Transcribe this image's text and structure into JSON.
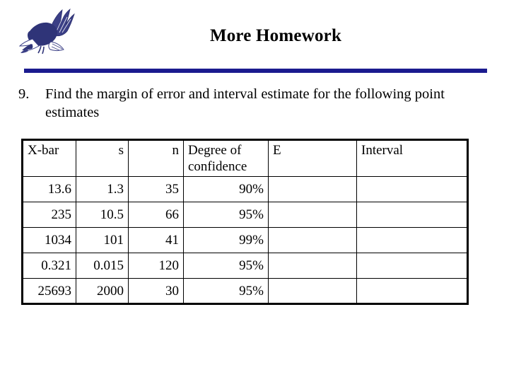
{
  "header": {
    "logo_icon": "eagle-logo",
    "title": "More Homework",
    "rule_color": "#1b1b8f"
  },
  "question": {
    "number": "9.",
    "text": "Find the margin of error and interval estimate for the following point estimates"
  },
  "table": {
    "columns": [
      {
        "label": "X-bar",
        "align": "left"
      },
      {
        "label": "s",
        "align": "right"
      },
      {
        "label": "n",
        "align": "right"
      },
      {
        "label": "Degree of confidence",
        "align": "left"
      },
      {
        "label": "E",
        "align": "left"
      },
      {
        "label": "Interval",
        "align": "left"
      }
    ],
    "rows": [
      {
        "xbar": "13.6",
        "s": "1.3",
        "n": "35",
        "confidence": "90%",
        "e": "",
        "interval": ""
      },
      {
        "xbar": "235",
        "s": "10.5",
        "n": "66",
        "confidence": "95%",
        "e": "",
        "interval": ""
      },
      {
        "xbar": "1034",
        "s": "101",
        "n": "41",
        "confidence": "99%",
        "e": "",
        "interval": ""
      },
      {
        "xbar": "0.321",
        "s": "0.015",
        "n": "120",
        "confidence": "95%",
        "e": "",
        "interval": ""
      },
      {
        "xbar": "25693",
        "s": "2000",
        "n": "30",
        "confidence": "95%",
        "e": "",
        "interval": ""
      }
    ]
  }
}
